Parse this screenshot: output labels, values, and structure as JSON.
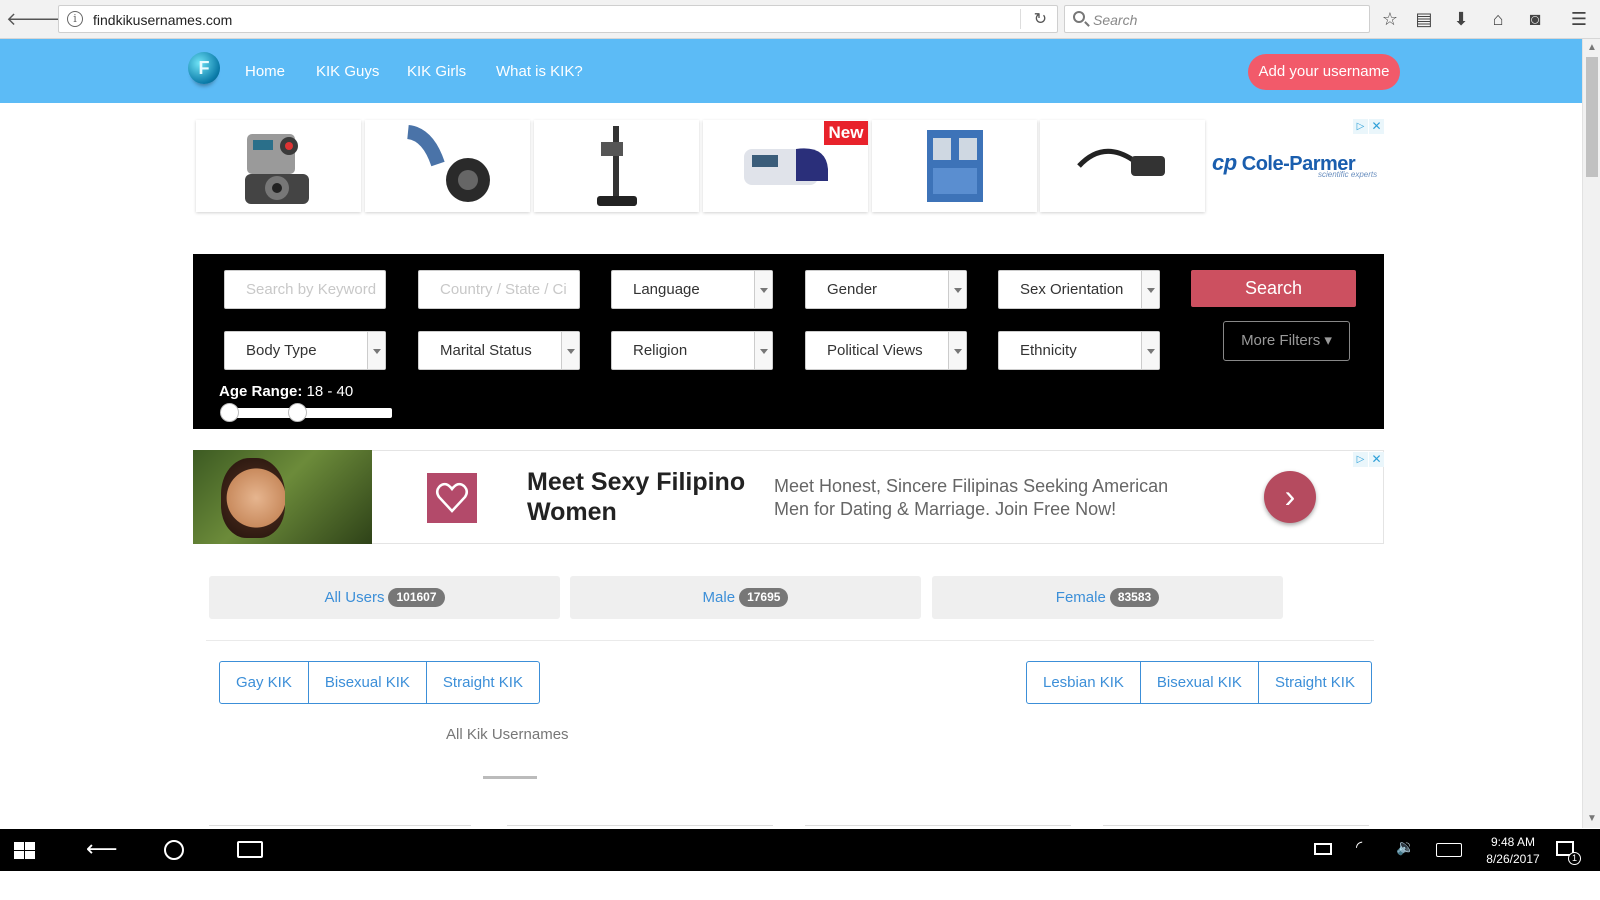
{
  "browser": {
    "url": "findkikusernames.com",
    "search_placeholder": "Search",
    "back_icon": "back-arrow-icon",
    "forward_icon": "forward-arrow-icon"
  },
  "header": {
    "logo_letter": "F",
    "nav": [
      "Home",
      "KIK Guys",
      "KIK Girls",
      "What is KIK?"
    ],
    "add_button": "Add your username"
  },
  "product_ad": {
    "new_badge": "New",
    "brand": "Cole-Parmer",
    "brand_mark": "cp",
    "brand_tagline": "scientific experts",
    "adchoice_play": "▷",
    "adchoice_close": "✕"
  },
  "search_panel": {
    "keyword_placeholder": "Search by Keyword",
    "location_placeholder": "Country / State / Ci",
    "language": "Language",
    "gender": "Gender",
    "sex_orientation": "Sex Orientation",
    "body_type": "Body Type",
    "marital_status": "Marital Status",
    "religion": "Religion",
    "political_views": "Political Views",
    "ethnicity": "Ethnicity",
    "search_button": "Search",
    "more_filters": "More Filters ▾",
    "age_label": "Age Range:",
    "age_value": "18 - 40",
    "age_min": 18,
    "age_max": 40
  },
  "banner_ad": {
    "title": "Meet Sexy Filipino Women",
    "text": "Meet Honest, Sincere Filipinas Seeking American Men for Dating & Marriage. Join Free Now!",
    "arrow": "›"
  },
  "user_tabs": [
    {
      "label": "All Users",
      "count": "101607"
    },
    {
      "label": "Male",
      "count": "17695"
    },
    {
      "label": "Female",
      "count": "83583"
    }
  ],
  "male_filters": [
    "Gay KIK",
    "Bisexual KIK",
    "Straight KIK"
  ],
  "female_filters": [
    "Lesbian KIK",
    "Bisexual KIK",
    "Straight KIK"
  ],
  "section_title": "All Kik Usernames",
  "taskbar": {
    "time": "9:48 AM",
    "date": "8/26/2017",
    "notification_count": "1"
  },
  "colors": {
    "header_bg": "#5cbbf6",
    "add_button": "#f25a6a",
    "search_button": "#cc5060",
    "link_blue": "#3c8fd8"
  }
}
